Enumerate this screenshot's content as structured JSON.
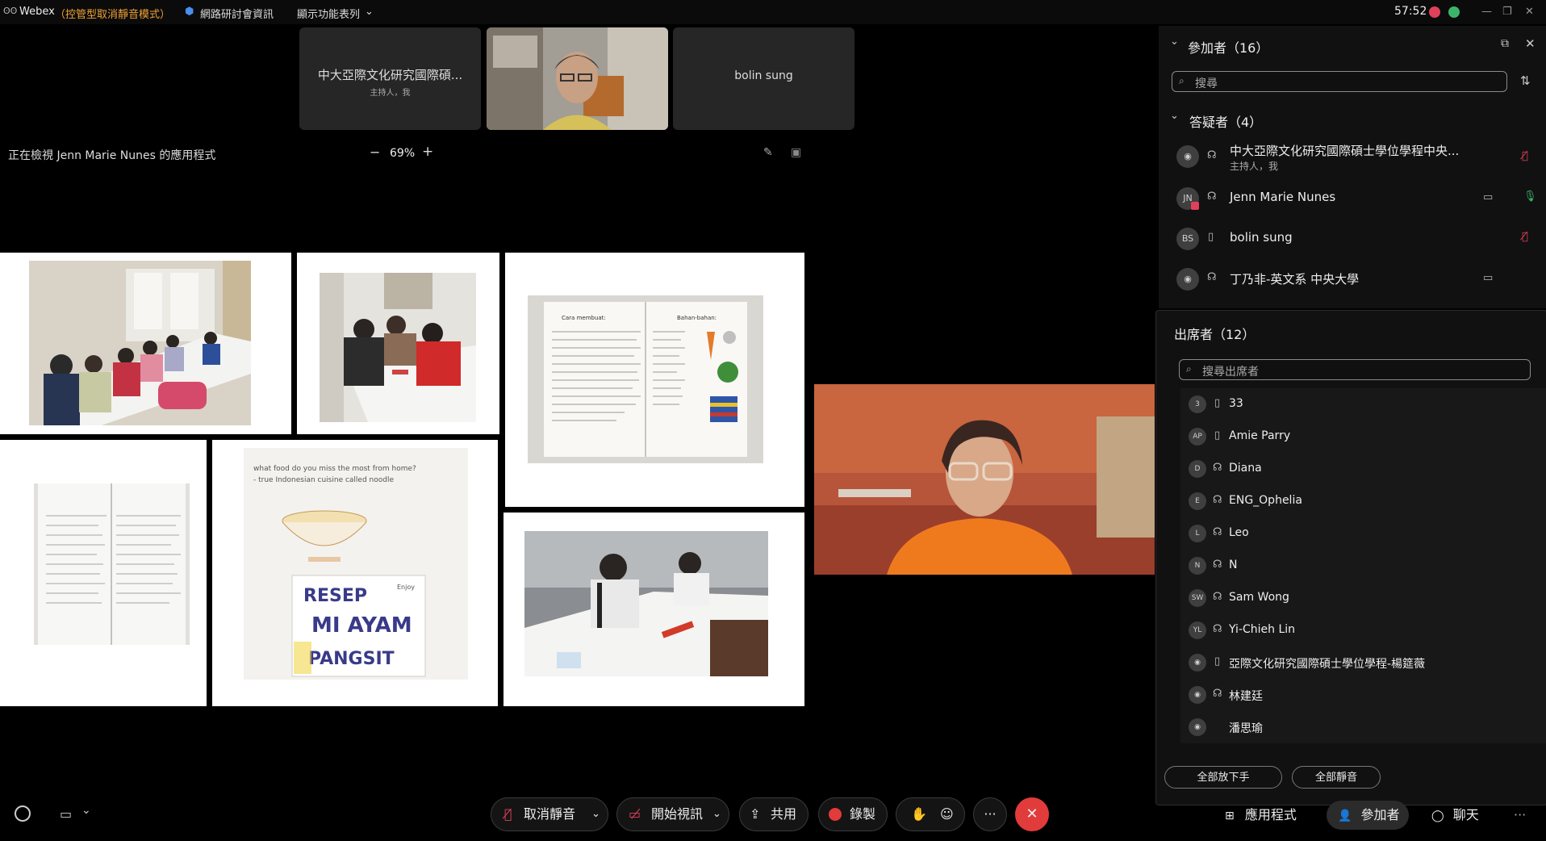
{
  "topbar": {
    "app_name": "Webex",
    "mode": "（控管型取消靜音模式）",
    "webinar_info": "網路研討會資訊",
    "layout": "顯示功能表列",
    "timer": "57:52"
  },
  "thumbnails": {
    "host_name": "中大亞際文化研究國際碩...",
    "host_sub": "主持人，我",
    "bolin_name": "bolin sung"
  },
  "share": {
    "viewing": "正在檢視 Jenn Marie Nunes 的應用程式",
    "zoom": "69%",
    "minus": "−",
    "plus": "+"
  },
  "slides": {
    "recipe_left_title": "Cara membuat:",
    "recipe_right_title": "Bahan-bahan:",
    "doc_question": "what food do you miss the most from home?",
    "doc_answer": "- true Indonesian cuisine called noodle",
    "doc_title1": "RESEP",
    "doc_title2": "MI AYAM",
    "doc_title3": "PANGSIT",
    "doc_enjoy": "Enjoy"
  },
  "participants_panel": {
    "title": "參加者（16）",
    "search_placeholder": "搜尋",
    "panelists_header": "答疑者（4）",
    "panelists": [
      {
        "initials": "",
        "name": "中大亞際文化研究國際碩士學位學程中央...",
        "sub": "主持人，我"
      },
      {
        "initials": "JN",
        "name": "Jenn Marie Nunes",
        "sub": ""
      },
      {
        "initials": "BS",
        "name": "bolin sung",
        "sub": ""
      },
      {
        "initials": "",
        "name": "丁乃非-英文系 中央大學",
        "sub": ""
      }
    ]
  },
  "attendees_panel": {
    "title": "出席者（12）",
    "search_placeholder": "搜尋出席者",
    "attendees": [
      {
        "initials": "3",
        "name": "33",
        "device": "phone"
      },
      {
        "initials": "AP",
        "name": "Amie Parry",
        "device": "phone"
      },
      {
        "initials": "D",
        "name": "Diana",
        "device": "headset"
      },
      {
        "initials": "E",
        "name": "ENG_Ophelia",
        "device": "headset"
      },
      {
        "initials": "L",
        "name": "Leo",
        "device": "headset"
      },
      {
        "initials": "N",
        "name": "N",
        "device": "headset"
      },
      {
        "initials": "SW",
        "name": "Sam Wong",
        "device": "headset"
      },
      {
        "initials": "YL",
        "name": "Yi-Chieh Lin",
        "device": "headset"
      },
      {
        "initials": "",
        "name": "亞際文化研究國際碩士學位學程-楊筵薇",
        "device": "phone"
      },
      {
        "initials": "",
        "name": "林建廷",
        "device": "headset"
      },
      {
        "initials": "",
        "name": "潘思瑜",
        "device": "none"
      }
    ],
    "lower_hands": "全部放下手",
    "mute_all": "全部靜音"
  },
  "toolbar": {
    "unmute": "取消靜音",
    "start_video": "開始視訊",
    "share": "共用",
    "record": "錄製",
    "more": "···"
  },
  "tabs": {
    "apps": "應用程式",
    "participants": "參加者",
    "chat": "聊天",
    "more": "···"
  },
  "colors": {
    "accent_orange": "#f0a236",
    "end_red": "#e23b3b",
    "mute_red": "#e0405a",
    "green": "#3bb56a"
  }
}
